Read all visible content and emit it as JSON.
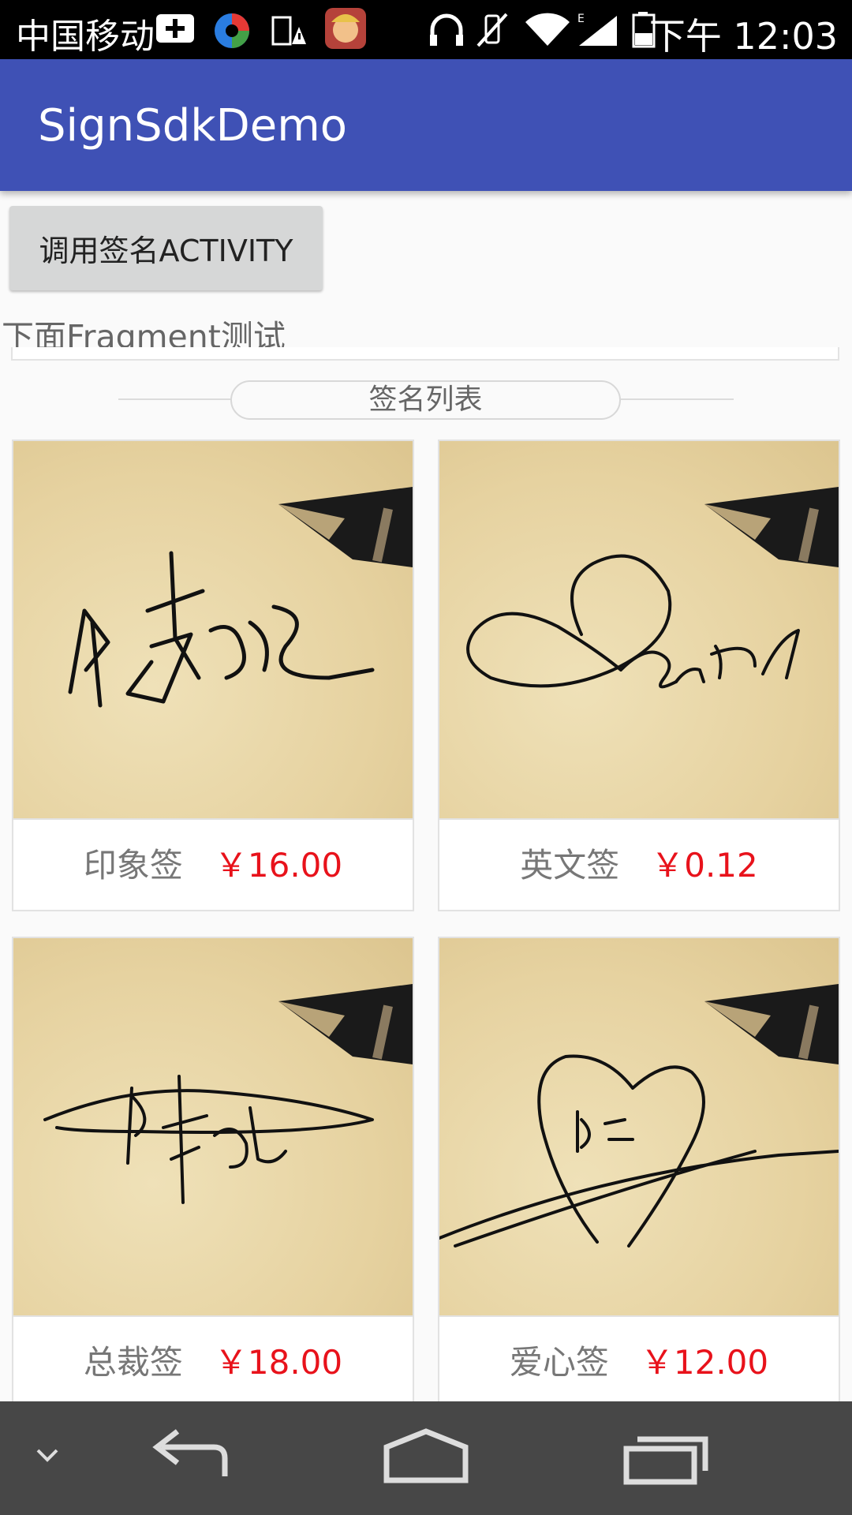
{
  "status_bar": {
    "carrier": "中国移动",
    "time": "下午 12:03",
    "icons": [
      "plus-icon",
      "app-icon",
      "warning-icon",
      "game-avatar-icon",
      "headphones-icon",
      "vibrate-off-icon",
      "wifi-icon",
      "signal-icon",
      "battery-icon"
    ]
  },
  "app_bar": {
    "title": "SignSdkDemo",
    "color": "#3f51b5"
  },
  "activity_button": {
    "label": "调用签名ACTIVITY"
  },
  "fragment_label": "下面Fragment测试",
  "list_title": "签名列表",
  "items": [
    {
      "name": "印象签",
      "price": "￥16.00",
      "image": "signature-chinese-style"
    },
    {
      "name": "英文签",
      "price": "￥0.12",
      "image": "signature-david"
    },
    {
      "name": "总裁签",
      "price": "￥18.00",
      "image": "signature-ceo-style"
    },
    {
      "name": "爱心签",
      "price": "￥12.00",
      "image": "signature-heart-style"
    }
  ],
  "price_color": "#e8121b",
  "nav_bar": {
    "icons": [
      "chevron-down-icon",
      "back-icon",
      "home-icon",
      "recents-icon"
    ]
  }
}
